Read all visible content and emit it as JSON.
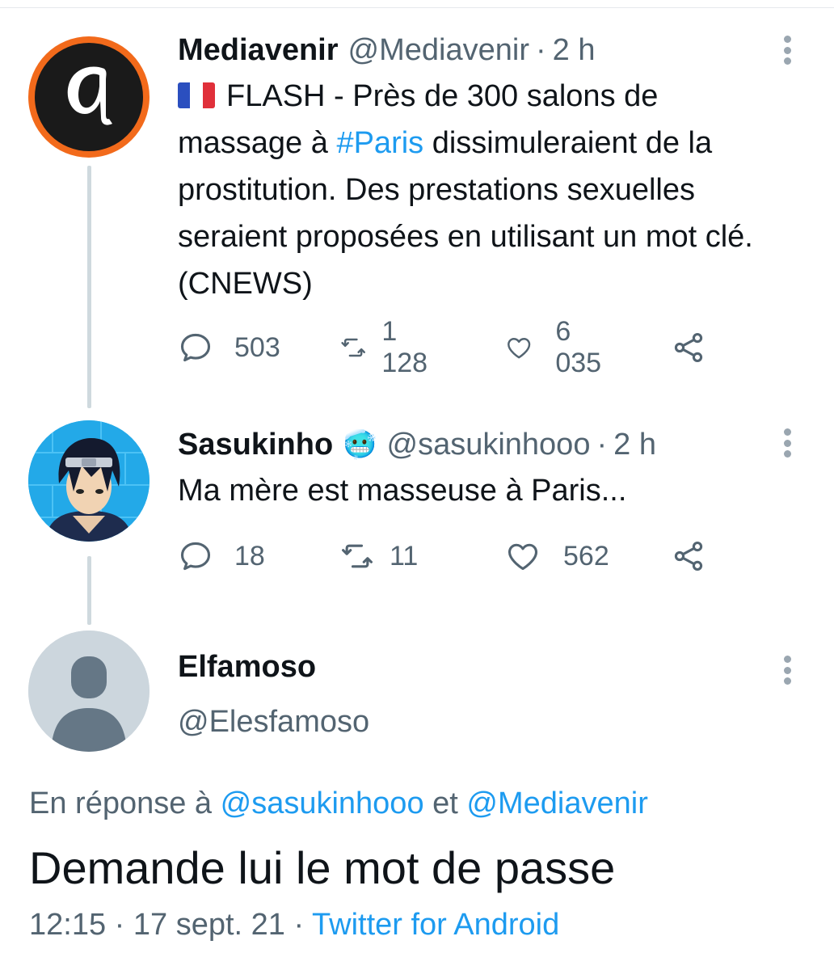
{
  "tweets": [
    {
      "name": "Mediavenir",
      "handle": "@Mediavenir",
      "separator": "·",
      "time": "2 h",
      "flag_icon": "france-flag-icon",
      "text_before_hashtag": "FLASH - Près de 300 salons de massage à",
      "hashtag": "#Paris",
      "text_after_hashtag": "dissimuleraient de la prostitution. Des prestations sexuelles seraient proposées en utilisant un mot clé. (CNEWS)",
      "replies": "503",
      "retweets": "1 128",
      "likes": "6 035"
    },
    {
      "name": "Sasukinho",
      "name_emoji": "🥶",
      "handle": "@sasukinhooo",
      "separator": "·",
      "time": "2 h",
      "text": "Ma mère est masseuse à Paris...",
      "replies": "18",
      "retweets": "11",
      "likes": "562"
    }
  ],
  "focus_tweet": {
    "name": "Elfamoso",
    "handle": "@Elesfamoso",
    "reply_prefix": "En réponse à",
    "reply_mention_1": "@sasukinhooo",
    "reply_conjunction": "et",
    "reply_mention_2": "@Mediavenir",
    "text": "Demande lui le mot de passe",
    "time": "12:15",
    "separator_1": "·",
    "date": "17 sept. 21",
    "separator_2": "·",
    "source": "Twitter for Android"
  },
  "colors": {
    "accent": "#1d9bf0",
    "secondary_text": "#536471",
    "thread_line": "#cfd9de",
    "mediavenir_ring": "#f26a1b"
  }
}
